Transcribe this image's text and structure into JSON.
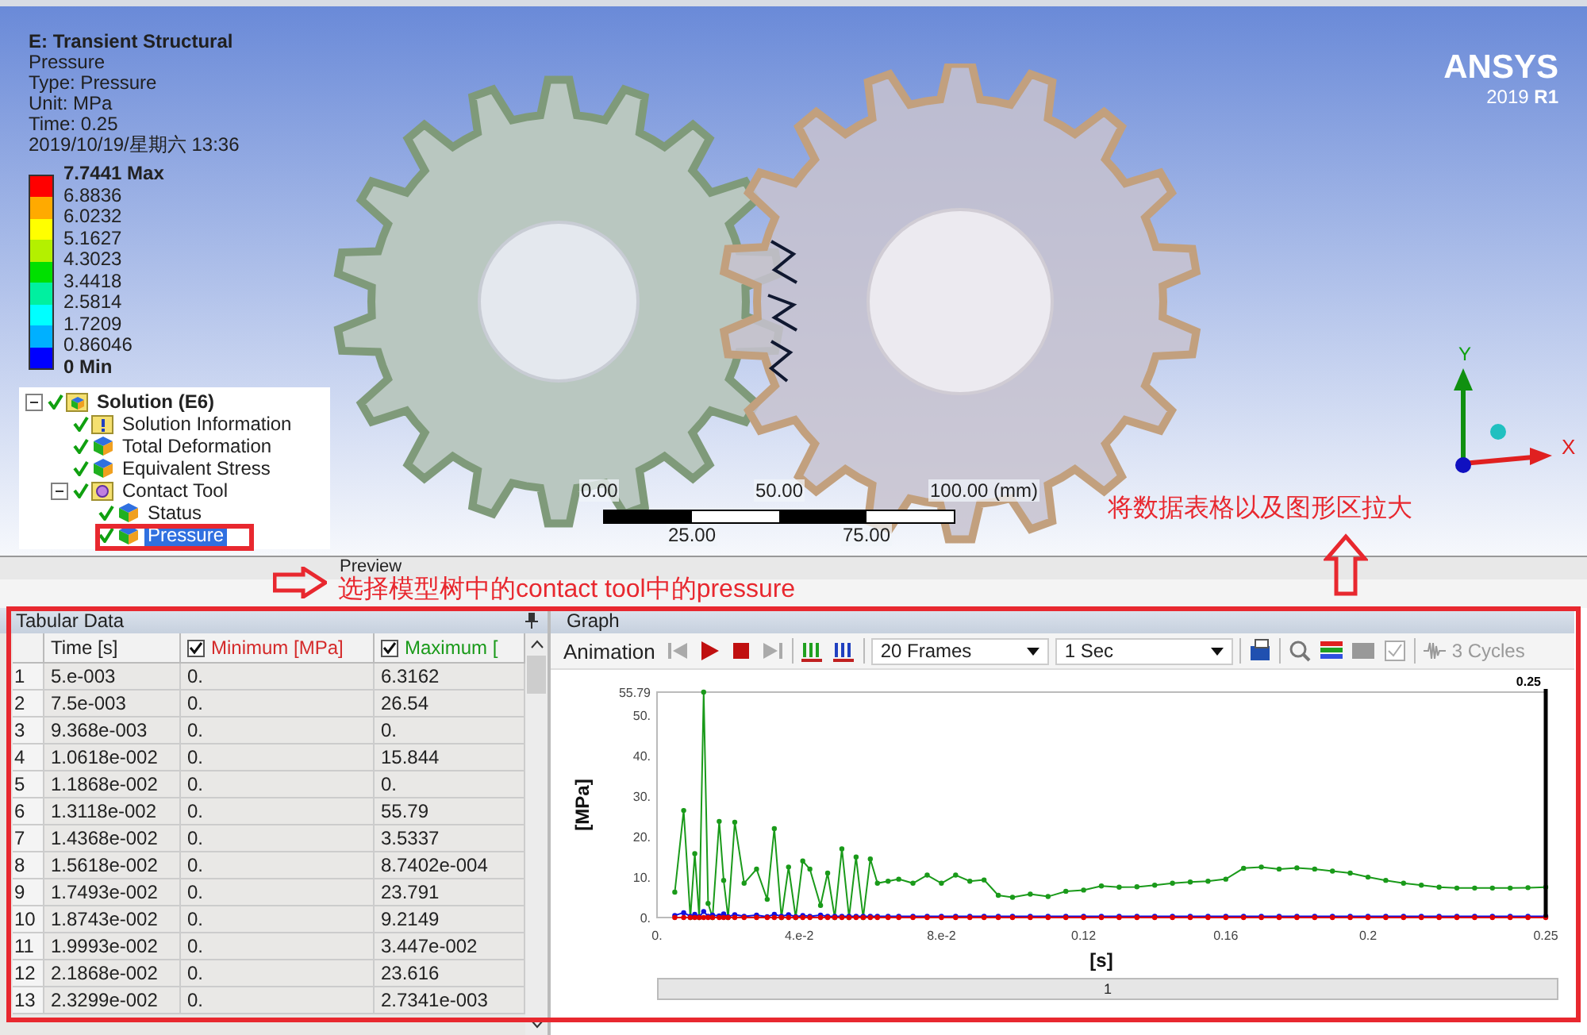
{
  "viewport": {
    "info": {
      "title": "E: Transient Structural",
      "lines": [
        "Pressure",
        "Type: Pressure",
        "Unit: MPa",
        "Time: 0.25",
        "2019/10/19/星期六 13:36"
      ]
    },
    "legend": {
      "labels": [
        "7.7441 Max",
        "6.8836",
        "6.0232",
        "5.1627",
        "4.3023",
        "3.4418",
        "2.5814",
        "1.7209",
        "0.86046",
        "0 Min"
      ],
      "bands": [
        {
          "color": "#ff0000"
        },
        {
          "color": "#ffaa00"
        },
        {
          "color": "#ffff00"
        },
        {
          "color": "#b4f000"
        },
        {
          "color": "#00e000"
        },
        {
          "color": "#00f0a0"
        },
        {
          "color": "#00ffff"
        },
        {
          "color": "#00b0ff"
        },
        {
          "color": "#0000ff"
        }
      ]
    },
    "logo": {
      "name": "ANSYS",
      "version": "2019 **R1**"
    },
    "scale_bar": {
      "top_labels": [
        "0.00",
        "50.00",
        "100.00 (mm)"
      ],
      "bottom_labels": [
        "25.00",
        "75.00"
      ]
    },
    "triad": {
      "x_label": "X",
      "y_label": "Y"
    },
    "tree": [
      {
        "label": "Solution (E6)",
        "kind": "solution",
        "expanded": true,
        "selected": false,
        "children": [
          {
            "label": "Solution Information",
            "kind": "info",
            "selected": false
          },
          {
            "label": "Total Deformation",
            "kind": "result",
            "selected": false
          },
          {
            "label": "Equivalent Stress",
            "kind": "result",
            "selected": false
          },
          {
            "label": "Contact Tool",
            "kind": "tool",
            "expanded": true,
            "selected": false,
            "children": [
              {
                "label": "Status",
                "kind": "result",
                "selected": false
              },
              {
                "label": "Pressure",
                "kind": "result",
                "selected": true
              }
            ]
          }
        ]
      }
    ],
    "tabs": [
      {
        "label": "Preview"
      }
    ]
  },
  "annotations": [
    {
      "kind": "arrow_right",
      "text": "选择模型树中的contact tool中的pressure"
    },
    {
      "kind": "arrow_up",
      "text": "将数据表格以及图形区拉大"
    }
  ],
  "tabular": {
    "title": "Tabular Data",
    "columns": [
      {
        "kind": "index"
      },
      {
        "kind": "plain",
        "label": "Time [s]"
      },
      {
        "kind": "series",
        "label": "Minimum [MPa]",
        "checked": true,
        "color": "#d42a2a"
      },
      {
        "kind": "series",
        "label": "Maximum [",
        "checked": true,
        "color": "#1a9a1a"
      }
    ],
    "rows": [
      [
        "1",
        "5.e-003",
        "0.",
        "6.3162"
      ],
      [
        "2",
        "7.5e-003",
        "0.",
        "26.54"
      ],
      [
        "3",
        "9.368e-003",
        "0.",
        "0."
      ],
      [
        "4",
        "1.0618e-002",
        "0.",
        "15.844"
      ],
      [
        "5",
        "1.1868e-002",
        "0.",
        "0."
      ],
      [
        "6",
        "1.3118e-002",
        "0.",
        "55.79"
      ],
      [
        "7",
        "1.4368e-002",
        "0.",
        "3.5337"
      ],
      [
        "8",
        "1.5618e-002",
        "0.",
        "8.7402e-004"
      ],
      [
        "9",
        "1.7493e-002",
        "0.",
        "23.791"
      ],
      [
        "10",
        "1.8743e-002",
        "0.",
        "9.2149"
      ],
      [
        "11",
        "1.9993e-002",
        "0.",
        "3.447e-002"
      ],
      [
        "12",
        "2.1868e-002",
        "0.",
        "23.616"
      ],
      [
        "13",
        "2.3299e-002",
        "0.",
        "2.7341e-003"
      ]
    ]
  },
  "graph": {
    "title": "Graph",
    "toolbar": {
      "label": "Animation",
      "frames": "20 Frames",
      "duration": "1 Sec",
      "cycles": "3 Cycles",
      "cycles_disabled": true
    },
    "chart_data": {
      "type": "line",
      "xlabel": "[s]",
      "ylabel": "[MPa]",
      "xlim": [
        0,
        0.25
      ],
      "ylim": [
        0,
        55.79
      ],
      "xticks": [
        {
          "value": 0,
          "label": "0."
        },
        {
          "value": 0.04,
          "label": "4.e-2"
        },
        {
          "value": 0.08,
          "label": "8.e-2"
        },
        0.12,
        0.16,
        0.2,
        0.25
      ],
      "yticks": [
        {
          "value": 0,
          "label": "0."
        },
        {
          "value": 10,
          "label": "10."
        },
        {
          "value": 20,
          "label": "20."
        },
        {
          "value": 30,
          "label": "30."
        },
        {
          "value": 40,
          "label": "40."
        },
        {
          "value": 50,
          "label": "50."
        },
        55.79
      ],
      "x": [
        0.005,
        0.0075,
        0.009368,
        0.010618,
        0.011868,
        0.013118,
        0.014368,
        0.015618,
        0.017493,
        0.018743,
        0.019993,
        0.021868,
        0.0245,
        0.028,
        0.031,
        0.033,
        0.035,
        0.037,
        0.039,
        0.041,
        0.043,
        0.046,
        0.048,
        0.05,
        0.052,
        0.054,
        0.056,
        0.058,
        0.06,
        0.062,
        0.065,
        0.068,
        0.072,
        0.076,
        0.08,
        0.084,
        0.088,
        0.092,
        0.096,
        0.1,
        0.105,
        0.11,
        0.115,
        0.12,
        0.125,
        0.13,
        0.135,
        0.14,
        0.145,
        0.15,
        0.155,
        0.16,
        0.165,
        0.17,
        0.175,
        0.18,
        0.185,
        0.19,
        0.195,
        0.2,
        0.205,
        0.21,
        0.215,
        0.22,
        0.225,
        0.23,
        0.235,
        0.24,
        0.245,
        0.25
      ],
      "series": [
        {
          "color": "#1a9a1a",
          "marker": "circle",
          "values": [
            6.3,
            26.5,
            0,
            15.8,
            0,
            55.79,
            3.5,
            0,
            23.8,
            9.2,
            0,
            23.6,
            8.5,
            12,
            4.5,
            22,
            0,
            12.5,
            0,
            14,
            12,
            3,
            11,
            0,
            17,
            0,
            15,
            0,
            14.5,
            8.5,
            9,
            9.5,
            8.5,
            10.5,
            8.5,
            10.5,
            9,
            9.3,
            5.5,
            5,
            5.8,
            5.2,
            6.5,
            6.8,
            7.8,
            7.5,
            7.6,
            8,
            8.5,
            8.8,
            9,
            9.5,
            12.2,
            12.5,
            12,
            12.3,
            12,
            11.5,
            11,
            10,
            9.2,
            8.5,
            8,
            7.5,
            7.3,
            7.3,
            7.3,
            7.3,
            7.4,
            7.5
          ]
        },
        {
          "color": "#1010e0",
          "marker": "circle",
          "values": [
            0.5,
            1.2,
            0.3,
            0.8,
            0.2,
            1.5,
            0.3,
            0.6,
            0.4,
            0.9,
            0.2,
            0.7,
            0.3,
            0.6,
            0.2,
            0.8,
            0.3,
            0.7,
            0.2,
            0.5,
            0.3,
            0.6,
            0.3,
            0.3,
            0.3,
            0.3,
            0.3,
            0.3,
            0.3,
            0.3,
            0.3,
            0.3,
            0.3,
            0.3,
            0.3,
            0.3,
            0.3,
            0.3,
            0.3,
            0.3,
            0.3,
            0.3,
            0.3,
            0.3,
            0.3,
            0.3,
            0.3,
            0.3,
            0.3,
            0.3,
            0.3,
            0.3,
            0.3,
            0.3,
            0.3,
            0.3,
            0.3,
            0.3,
            0.3,
            0.3,
            0.3,
            0.3,
            0.3,
            0.3,
            0.3,
            0.3,
            0.3,
            0.3,
            0.3,
            0.3
          ]
        },
        {
          "color": "#e00000",
          "marker": "circle",
          "values": [
            0,
            0,
            0,
            0,
            0,
            0,
            0,
            0,
            0,
            0,
            0,
            0,
            0,
            0,
            0,
            0,
            0,
            0,
            0,
            0,
            0,
            0,
            0,
            0,
            0,
            0,
            0,
            0,
            0,
            0,
            0,
            0,
            0,
            0,
            0,
            0,
            0,
            0,
            0,
            0,
            0,
            0,
            0,
            0,
            0,
            0,
            0,
            0,
            0,
            0,
            0,
            0,
            0,
            0,
            0,
            0,
            0,
            0,
            0,
            0,
            0,
            0,
            0,
            0,
            0,
            0,
            0,
            0,
            0,
            0
          ]
        }
      ],
      "annotations": [
        {
          "text": "0.25"
        }
      ]
    },
    "slider_label": "1"
  }
}
